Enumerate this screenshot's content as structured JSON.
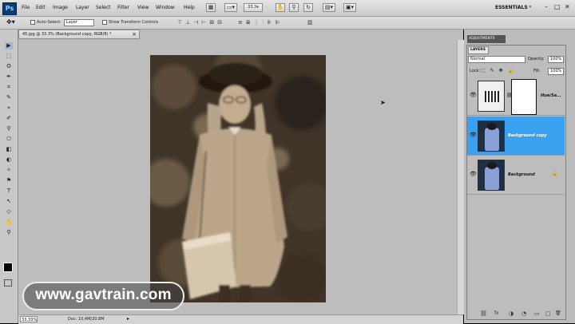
{
  "app": {
    "logo": "Ps",
    "workspace": "ESSENTIALS"
  },
  "menu": [
    "File",
    "Edit",
    "Image",
    "Layer",
    "Select",
    "Filter",
    "View",
    "Window",
    "Help"
  ],
  "toolbar": {
    "zoom_value": "33.3",
    "icons": [
      "bridge-icon",
      "mini-bridge-icon",
      "screen-mode-icon",
      "hand-icon",
      "zoom-icon",
      "rotate-icon",
      "arrange-icon"
    ]
  },
  "window_controls": [
    "–",
    "□",
    "✕"
  ],
  "options": {
    "auto_select_label": "Auto-Select:",
    "auto_select_value": "Layer",
    "transform_label": "Show Transform Controls"
  },
  "tools": [
    "▶",
    "⬚",
    "ʘ",
    "✒",
    "⌗",
    "✎",
    "⌖",
    "✐",
    "⚲",
    "⎔",
    "◧",
    "◐",
    "✧",
    "⚑",
    "T",
    "↖",
    "◇",
    "✋",
    "⚲"
  ],
  "document": {
    "tab_title": "45.jpg @ 33.3% (Background copy, RGB/8) *",
    "close": "×",
    "zoom_status": "33.33%",
    "doc_size": "Doc: 10.4M/20.8M"
  },
  "watermark": "www.gavtrain.com",
  "panels": {
    "adjustments_tab": "ADJUSTMENTS",
    "layers_tab": "LAYERS",
    "blend_mode": "Normal",
    "opacity_label": "Opacity:",
    "opacity_value": "100%",
    "lock_label": "Lock:",
    "lock_icons": "⬚ ✎ ✥ 🔒",
    "fill_label": "Fill:",
    "fill_value": "100%"
  },
  "layers": [
    {
      "name": "Hue/Sa...",
      "type": "adjustment",
      "selected": false
    },
    {
      "name": "Background copy",
      "type": "image",
      "selected": true
    },
    {
      "name": "Background",
      "type": "image",
      "selected": false,
      "locked": true
    }
  ],
  "footer_icons": [
    "⛓",
    "fx",
    "◑",
    "◔",
    "▭",
    "▢",
    "🗑"
  ],
  "colors": {
    "selected_layer": "#3aa0f0",
    "workspace": "#bdbdbd",
    "sepia_dark": "#3b2f22",
    "sepia_light": "#c9b89f"
  }
}
